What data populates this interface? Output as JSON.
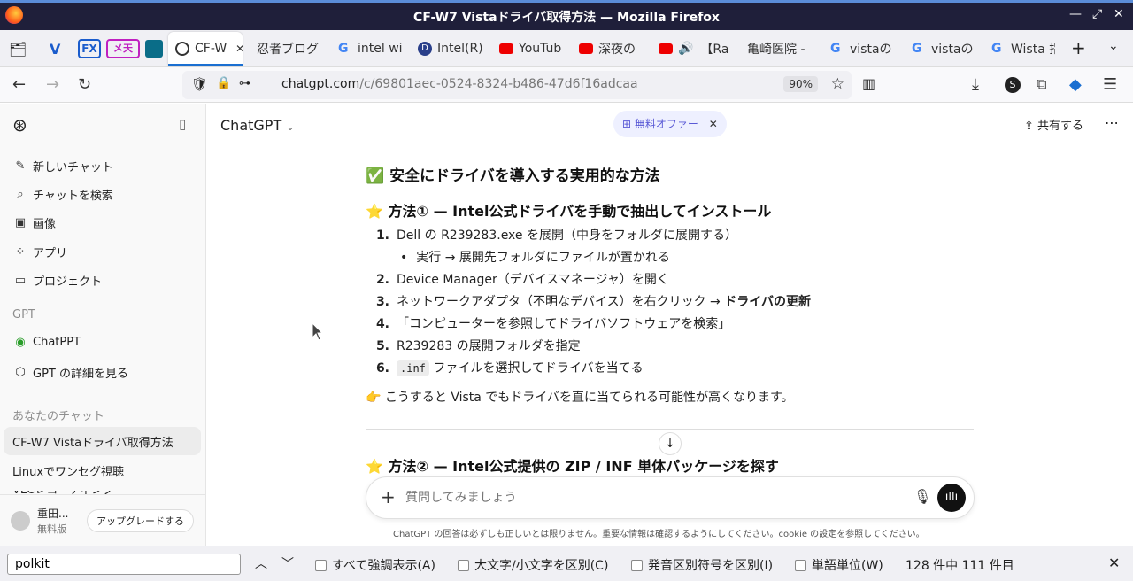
{
  "window": {
    "title": "CF-W7 Vistaドライバ取得方法 — Mozilla Firefox"
  },
  "tabs": [
    {
      "label": "CF-W",
      "active": true
    },
    {
      "label": "忍者ブログ"
    },
    {
      "label": "intel wi"
    },
    {
      "label": "Intel(R)"
    },
    {
      "label": "YouTub"
    },
    {
      "label": "深夜の"
    },
    {
      "label": "【Ra"
    },
    {
      "label": "亀崎医院 -"
    },
    {
      "label": "vistaの"
    },
    {
      "label": "vistaの"
    },
    {
      "label": "Wista 指"
    }
  ],
  "pinned": {
    "fx": "FX",
    "mt": "メ天"
  },
  "address": {
    "host": "chatgpt.com",
    "path": "/c/69801aec-0524-8324-b486-47d6f16adcaa",
    "zoom": "90%"
  },
  "sidebar": {
    "new_chat": "新しいチャット",
    "search": "チャットを検索",
    "images": "画像",
    "apps": "アプリ",
    "projects": "プロジェクト",
    "gpt_header": "GPT",
    "chatppt": "ChatPPT",
    "gpt_more": "GPT の詳細を見る",
    "your_chats": "あなたのチャット",
    "chats": [
      "CF-W7 Vistaドライバ取得方法",
      "Linuxでワンセグ視聴",
      "VLCレコーディング"
    ],
    "user_name": "重田...",
    "user_plan": "無料版",
    "upgrade": "アップグレードする"
  },
  "header": {
    "model": "ChatGPT",
    "offer": "無料オファー",
    "share": "共有する"
  },
  "content": {
    "h_main": "✅ 安全にドライバを導入する実用的な方法",
    "h1": "⭐ 方法① — Intel公式ドライバを手動で抽出してインストール",
    "steps": [
      {
        "n": "1.",
        "text": "Dell の R239283.exe を展開（中身をフォルダに展開する）"
      },
      {
        "n": "2.",
        "text": "Device Manager（デバイスマネージャ）を開く"
      },
      {
        "n": "3.",
        "pre": "ネットワークアダプタ（不明なデバイス）を右クリック → ",
        "bold": "ドライバの更新"
      },
      {
        "n": "4.",
        "text": "「コンピューターを参照してドライバソフトウェアを検索」"
      },
      {
        "n": "5.",
        "text": "R239283 の展開フォルダを指定"
      },
      {
        "n": "6.",
        "code": ".inf",
        "text": " ファイルを選択してドライバを当てる"
      }
    ],
    "sub_bullet": "実行 → 展開先フォルダにファイルが置かれる",
    "note": "👉 こうすると Vista でもドライバを直に当てられる可能性が高くなります。",
    "h2": "⭐ 方法② — Intel公式提供の ZIP / INF 単体パッケージを探す"
  },
  "composer": {
    "placeholder": "質問してみましょう"
  },
  "footer": {
    "pre": "ChatGPT の回答は必ずしも正しいとは限りません。重要な情報は確認するようにしてください。",
    "link": "cookie の設定",
    "post": "を参照してください。"
  },
  "findbar": {
    "query": "polkit",
    "highlight_all": "すべて強調表示(A)",
    "match_case": "大文字/小文字を区別(C)",
    "diacritics": "発音区別符号を区別(I)",
    "whole_words": "単語単位(W)",
    "result": "128 件中 111 件目"
  },
  "colors": {
    "titlebar": "#1f1f3a",
    "accent": "#1a6fd1",
    "offer_bg": "#eef0ff",
    "offer_text": "#5a5ad6"
  }
}
